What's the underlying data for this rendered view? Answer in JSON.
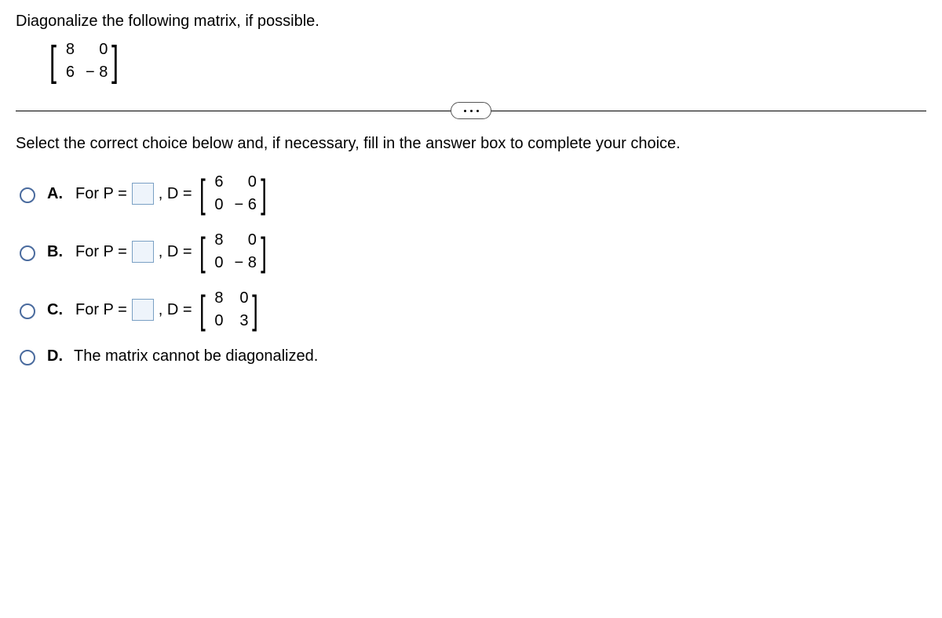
{
  "question": {
    "prompt": "Diagonalize the following matrix, if possible.",
    "matrix": {
      "r1c1": "8",
      "r1c2": "0",
      "r2c1": "6",
      "r2c2": "− 8"
    }
  },
  "instruction": "Select the correct choice below and, if necessary, fill in the answer box to complete your choice.",
  "choices": {
    "a": {
      "label": "A.",
      "prefix": "For P =",
      "mid": ", D =",
      "matrix": {
        "r1c1": "6",
        "r1c2": "0",
        "r2c1": "0",
        "r2c2": "− 6"
      }
    },
    "b": {
      "label": "B.",
      "prefix": "For P =",
      "mid": ", D =",
      "matrix": {
        "r1c1": "8",
        "r1c2": "0",
        "r2c1": "0",
        "r2c2": "− 8"
      }
    },
    "c": {
      "label": "C.",
      "prefix": "For P =",
      "mid": ", D =",
      "matrix": {
        "r1c1": "8",
        "r1c2": "0",
        "r2c1": "0",
        "r2c2": "3"
      }
    },
    "d": {
      "label": "D.",
      "text": "The matrix cannot be diagonalized."
    }
  }
}
